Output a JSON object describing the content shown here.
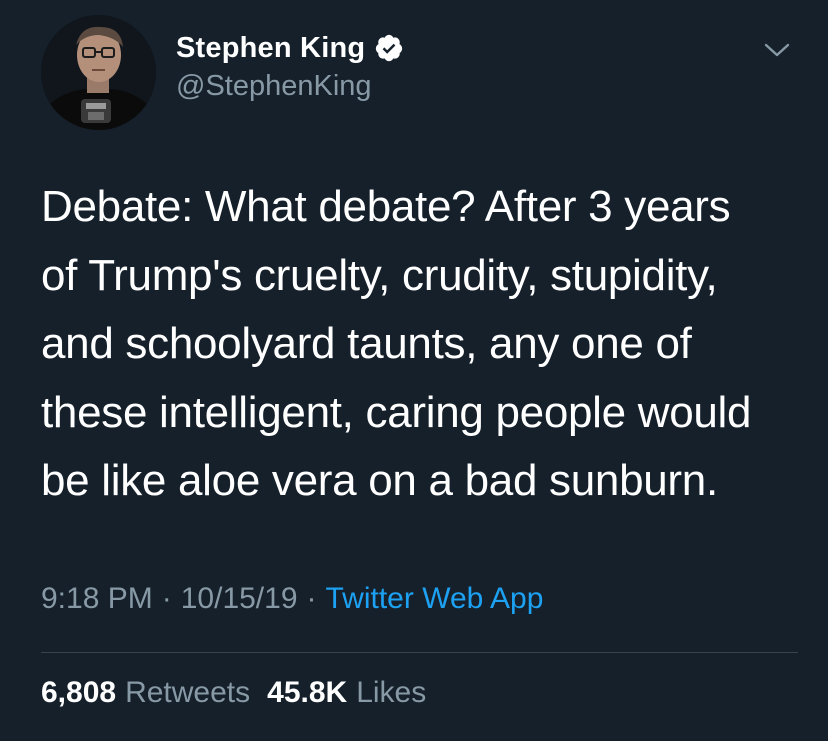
{
  "author": {
    "name": "Stephen King",
    "handle": "@StephenKing",
    "verified": true,
    "avatar_icon": "avatar-photo"
  },
  "tweet": {
    "text": "Debate: What debate? After 3 years\nof Trump's cruelty, crudity, stupidity,\nand schoolyard taunts, any one of\nthese intelligent, caring people would\nbe like aloe vera on a bad sunburn."
  },
  "meta": {
    "time": "9:18 PM",
    "separator": "·",
    "date": "10/15/19",
    "source": "Twitter Web App"
  },
  "stats": {
    "retweets_count": "6,808",
    "retweets_label": "Retweets",
    "likes_count": "45.8K",
    "likes_label": "Likes"
  },
  "colors": {
    "background": "#15202b",
    "text": "#ffffff",
    "secondary": "#8899a6",
    "accent": "#1da1f2",
    "divider": "#38444d"
  }
}
